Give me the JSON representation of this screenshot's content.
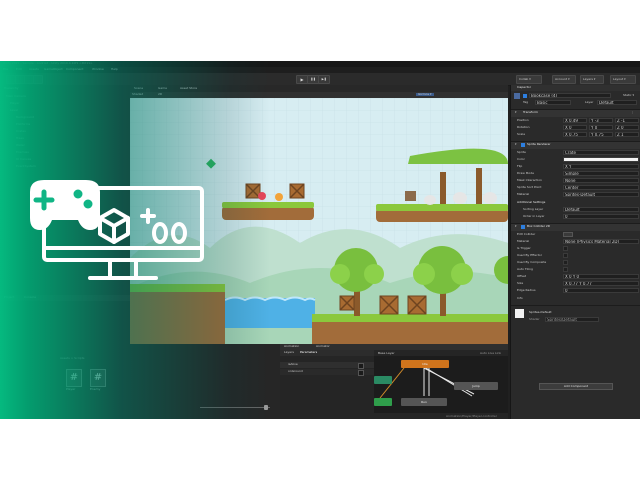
{
  "window": {
    "title": "Unity 2022 - Sample - Android - Unity 2019.4.10f1 <DX11>",
    "menu": [
      "File",
      "Edit",
      "Assets",
      "GameObject",
      "Component",
      "Window",
      "Help"
    ]
  },
  "toolbar": {
    "play": "▶",
    "pause": "❚❚",
    "step": "▶❚",
    "collab": "Collab ▾",
    "account": "Account ▾",
    "layers": "Layers ▾",
    "layout": "Layout ▾"
  },
  "scene": {
    "tabs": [
      "Scene",
      "Game",
      "Asset Store"
    ],
    "shading": "Shaded",
    "mode": "2D",
    "gizmos": "Gizmos ▾"
  },
  "inspector": {
    "tab": "Inspector",
    "object_name": "Bookcase (4)",
    "static_label": "Static ▾",
    "tag_label": "Tag",
    "tag_value": "Basic",
    "layer_label": "Layer",
    "layer_value": "Default",
    "transform": {
      "title": "Transform",
      "position_label": "Position",
      "position": [
        "X 0.49",
        "Y -3",
        "Z -1"
      ],
      "rotation_label": "Rotation",
      "rotation": [
        "X 0",
        "Y 0",
        "Z 0"
      ],
      "scale_label": "Scale",
      "scale": [
        "X 0.75",
        "Y 0.75",
        "Z 1"
      ]
    },
    "sprite_renderer": {
      "title": "Sprite Renderer",
      "rows": [
        {
          "label": "Sprite",
          "value": "Crate"
        },
        {
          "label": "Color",
          "value": ""
        },
        {
          "label": "Flip",
          "value": "X   Y"
        },
        {
          "label": "Draw Mode",
          "value": "Simple"
        },
        {
          "label": "Mask Interaction",
          "value": "None"
        },
        {
          "label": "Sprite Sort Point",
          "value": "Center"
        },
        {
          "label": "Material",
          "value": "Sprites-Default"
        }
      ],
      "additional": "Additional Settings",
      "sorting_label": "Sorting Layer",
      "sorting_value": "Default",
      "order_label": "Order in Layer",
      "order_value": "0"
    },
    "box_collider": {
      "title": "Box Collider 2D",
      "edit_label": "Edit Collider",
      "rows": [
        {
          "label": "Material",
          "value": "None (Physics Material 2D)"
        },
        {
          "label": "Is Trigger",
          "value": ""
        },
        {
          "label": "Used By Effector",
          "value": ""
        },
        {
          "label": "Used By Composite",
          "value": ""
        },
        {
          "label": "Auto Tiling",
          "value": ""
        },
        {
          "label": "Offset",
          "value": "X 0      Y 0"
        },
        {
          "label": "Size",
          "value": "X 0.77   Y 0.77"
        },
        {
          "label": "Edge Radius",
          "value": "0"
        }
      ],
      "info": "Info"
    },
    "material_name": "Sprites-Default",
    "shader_label": "Shader",
    "shader_value": "Sprites/Default",
    "add_component": "Add Component"
  },
  "animator": {
    "tabs": [
      "Animation",
      "Animator"
    ],
    "sub_tabs": [
      "Layers",
      "Parameters"
    ],
    "base_layer": "Base Layer",
    "auto_live": "Auto Live Link",
    "params": [
      "isAlive",
      "onGround"
    ],
    "states": [
      "Idle",
      "Jump",
      "Run"
    ],
    "footer": "Animation/Player/Player.controller"
  },
  "project": {
    "tabs": [
      "Project",
      "Console"
    ],
    "breadcrumb": "Assets > Scripts",
    "files": [
      "Player",
      "Enemy"
    ]
  },
  "hierarchy": {
    "tab": "Hierarchy",
    "items": [
      "Main Camera",
      "Player",
      "Level",
      "Background",
      "Platforms",
      "Crates",
      "Trees",
      "Water",
      "Enemies",
      "UI Canvas",
      "EventSystem"
    ]
  },
  "logo": {
    "icon": "gamepad-monitor-icon",
    "color": "#ffffff"
  },
  "colors": {
    "accent_green": "#05c58a",
    "panel": "#2a2a2a",
    "sky": "#d6ebf1",
    "grass": "#8bc83c",
    "water": "#4fb1e6"
  }
}
